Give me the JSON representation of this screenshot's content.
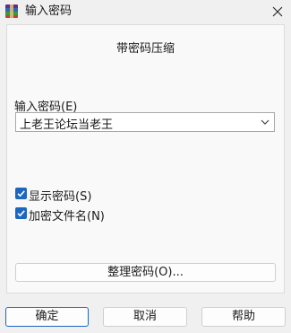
{
  "window": {
    "title": "输入密码",
    "close_icon": "close-icon",
    "app_icon": "winrar-icon"
  },
  "dialog": {
    "profile_title": "带密码压缩",
    "password_label": "输入密码(E)",
    "password_value": "上老王论坛当老王",
    "dropdown_icon": "chevron-down-icon",
    "checkboxes": [
      {
        "label": "显示密码(S)",
        "checked": true
      },
      {
        "label": "加密文件名(N)",
        "checked": true
      }
    ],
    "manage_button": "整理密码(O)..."
  },
  "buttons": {
    "ok": "确定",
    "cancel": "取消",
    "help": "帮助"
  },
  "colors": {
    "accent": "#1e67c0",
    "window_bg": "#f0f0f0",
    "panel_bg": "#f9f9f9"
  }
}
